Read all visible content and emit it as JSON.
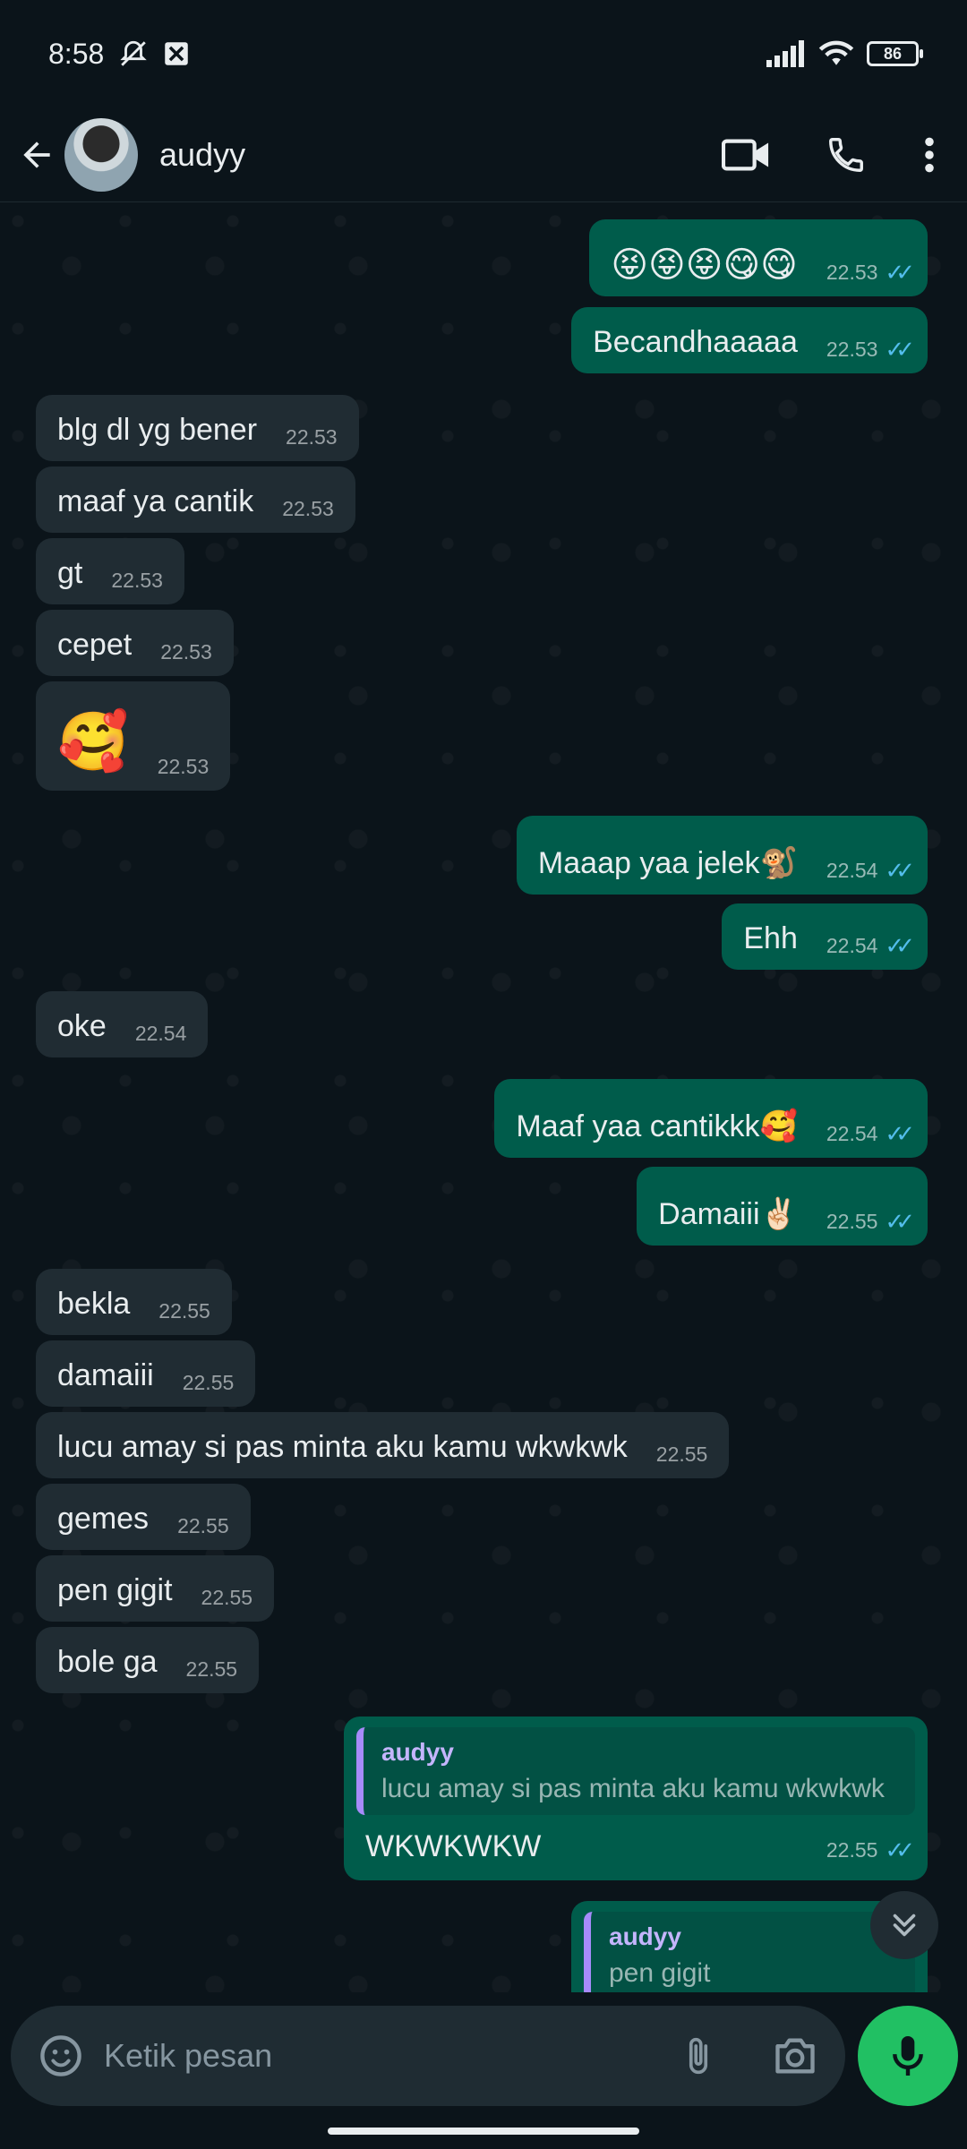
{
  "status_bar": {
    "time": "8:58",
    "battery": "86"
  },
  "header": {
    "contact_name": "audyy"
  },
  "messages": [
    {
      "id": "m1",
      "dir": "out",
      "text": "😝😝😝😋😋",
      "time": "22.53"
    },
    {
      "id": "m2",
      "dir": "out",
      "text": "Becandhaaaaa",
      "time": "22.53"
    },
    {
      "id": "m3",
      "dir": "in",
      "text": "blg dl yg bener",
      "time": "22.53"
    },
    {
      "id": "m4",
      "dir": "in",
      "text": "maaf ya cantik",
      "time": "22.53"
    },
    {
      "id": "m5",
      "dir": "in",
      "text": "gt",
      "time": "22.53"
    },
    {
      "id": "m6",
      "dir": "in",
      "text": "cepet",
      "time": "22.53"
    },
    {
      "id": "m7",
      "dir": "in",
      "text": "🥰",
      "time": "22.53"
    },
    {
      "id": "m8",
      "dir": "out",
      "text": "Maaap yaa jelek🐒",
      "time": "22.54"
    },
    {
      "id": "m9",
      "dir": "out",
      "text": "Ehh",
      "time": "22.54"
    },
    {
      "id": "m10",
      "dir": "in",
      "text": "oke",
      "time": "22.54"
    },
    {
      "id": "m11",
      "dir": "out",
      "text": "Maaf yaa cantikkk🥰",
      "time": "22.54"
    },
    {
      "id": "m12",
      "dir": "out",
      "text": "Damaiii✌🏻",
      "time": "22.55"
    },
    {
      "id": "m13",
      "dir": "in",
      "text": "bekla",
      "time": "22.55"
    },
    {
      "id": "m14",
      "dir": "in",
      "text": "damaiii",
      "time": "22.55"
    },
    {
      "id": "m15",
      "dir": "in",
      "text": "lucu amay si pas minta aku kamu wkwkwk",
      "time": "22.55"
    },
    {
      "id": "m16",
      "dir": "in",
      "text": "gemes",
      "time": "22.55"
    },
    {
      "id": "m17",
      "dir": "in",
      "text": "pen gigit",
      "time": "22.55"
    },
    {
      "id": "m18",
      "dir": "in",
      "text": "bole ga",
      "time": "22.55"
    }
  ],
  "reply_messages": [
    {
      "quote_author": "audyy",
      "quote_text": "lucu amay si pas minta aku kamu wkwkwk",
      "text": "WKWKWKW",
      "time": "22.55"
    },
    {
      "quote_author": "audyy",
      "quote_text": "pen gigit"
    }
  ],
  "ticks": "✓✓",
  "composer": {
    "placeholder": "Ketik pesan"
  },
  "icons": {
    "back": "arrow-left-icon",
    "video": "video-call-icon",
    "call": "phone-icon",
    "menu": "more-vert-icon",
    "emoji": "sticker-icon",
    "attach": "paperclip-icon",
    "camera": "camera-icon",
    "mic": "mic-icon",
    "scroll": "double-chevron-down-icon"
  },
  "colors": {
    "outgoing": "#005c4b",
    "incoming": "#202c33",
    "accent": "#21c063",
    "read_tick": "#53bdeb"
  }
}
